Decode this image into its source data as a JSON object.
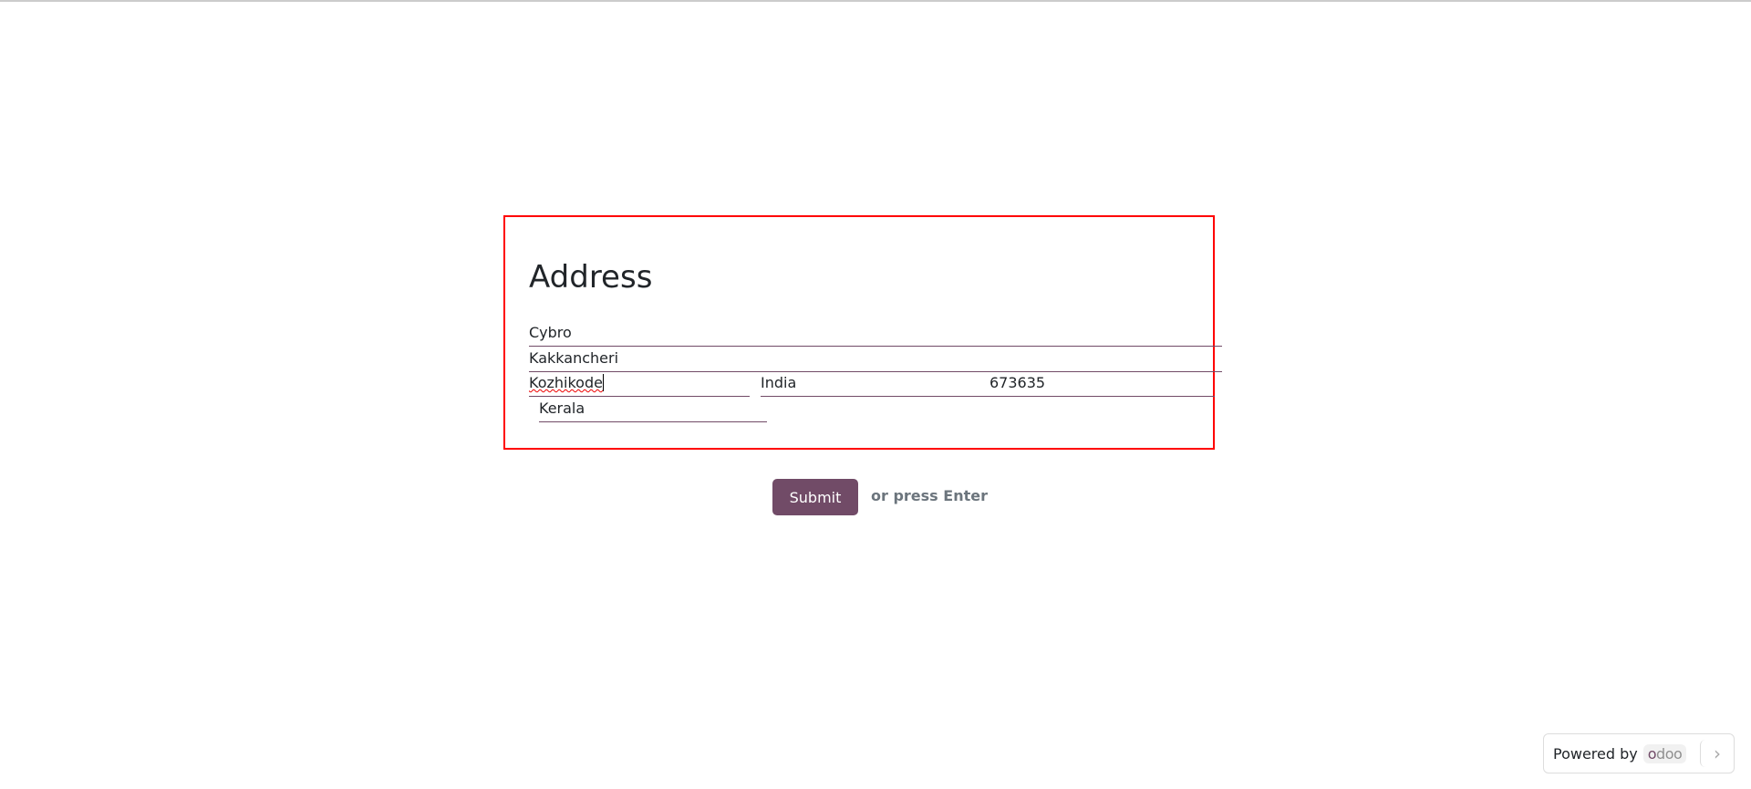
{
  "form": {
    "title": "Address",
    "street": "Cybro",
    "street2": "Kakkancheri",
    "city": "Kozhikode",
    "country": "India",
    "zip": "673635",
    "state": "Kerala"
  },
  "actions": {
    "submit_label": "Submit",
    "hint": "or press Enter"
  },
  "footer": {
    "powered_by": "Powered by",
    "brand": "odoo",
    "next_icon": "chevron-right-icon"
  },
  "colors": {
    "brand": "#714b67",
    "highlight_border": "#ff0000"
  }
}
